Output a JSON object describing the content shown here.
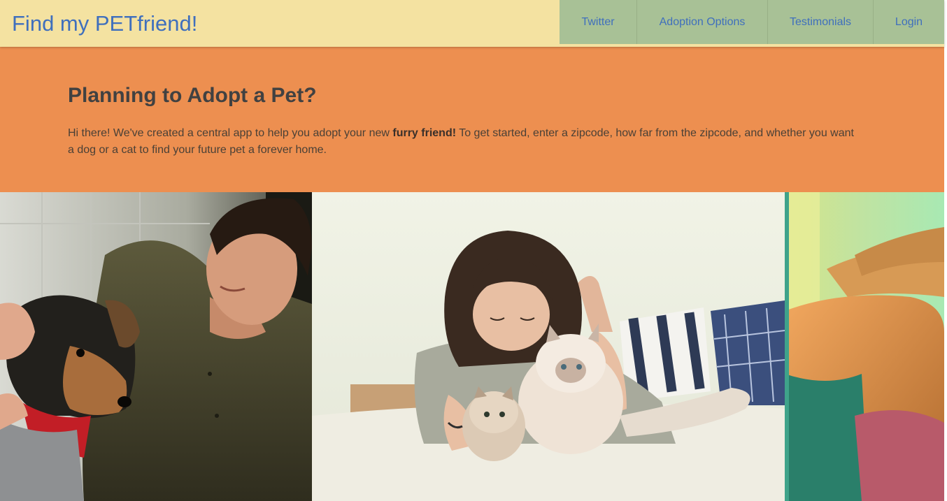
{
  "navbar": {
    "brand": "Find my PETfriend!",
    "items": [
      {
        "label": "Twitter"
      },
      {
        "label": "Adoption Options"
      },
      {
        "label": "Testimonials"
      },
      {
        "label": "Login"
      }
    ]
  },
  "hero": {
    "title": "Planning to Adopt a Pet?",
    "text_before": "Hi there! We've created a central app to help you adopt your new ",
    "text_bold": "furry friend!",
    "text_after": " To get started, enter a zipcode, how far from the zipcode, and whether you want a dog or a cat to find your future pet a forever home."
  },
  "colors": {
    "navbar_bg": "#f4e2a1",
    "nav_menu_bg": "#a8c196",
    "link_blue": "#3f6fbd",
    "hero_bg": "#ed8f50"
  }
}
